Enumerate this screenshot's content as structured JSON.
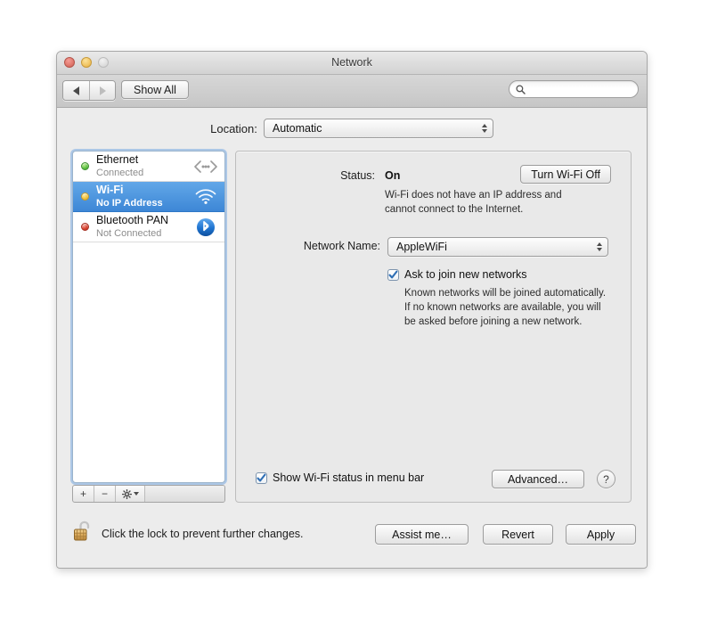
{
  "window": {
    "title": "Network",
    "traffic_lights": [
      "close",
      "minimize",
      "zoom"
    ]
  },
  "toolbar": {
    "back_icon": "triangle-left-icon",
    "forward_icon": "triangle-right-icon",
    "show_all_label": "Show All",
    "search": {
      "value": "",
      "placeholder": "",
      "icon": "search-icon"
    }
  },
  "location": {
    "label": "Location:",
    "value": "Automatic"
  },
  "sidebar": {
    "services": [
      {
        "name": "Ethernet",
        "status": "Connected",
        "dot": "green",
        "icon": "ethernet-icon",
        "selected": false
      },
      {
        "name": "Wi-Fi",
        "status": "No IP Address",
        "dot": "amber",
        "icon": "wifi-icon",
        "selected": true
      },
      {
        "name": "Bluetooth PAN",
        "status": "Not Connected",
        "dot": "red",
        "icon": "bluetooth-icon",
        "selected": false
      }
    ],
    "footer": {
      "add_label": "+",
      "remove_label": "−",
      "action_icon": "gear-icon"
    }
  },
  "detail": {
    "status_label": "Status:",
    "status_value": "On",
    "turn_off_label": "Turn Wi-Fi Off",
    "status_description": "Wi-Fi does not have an IP address and\ncannot connect to the Internet.",
    "status_description_line1": "Wi-Fi does not have an IP address and",
    "status_description_line2": "cannot connect to the Internet.",
    "network_name_label": "Network Name:",
    "network_name_value": "AppleWiFi",
    "ask_join_label": "Ask to join new networks",
    "ask_join_checked": true,
    "ask_join_help_line1": "Known networks will be joined automatically.",
    "ask_join_help_line2": "If no known networks are available, you will",
    "ask_join_help_line3": "be asked before joining a new network.",
    "show_status_label": "Show Wi-Fi status in menu bar",
    "show_status_checked": true,
    "advanced_label": "Advanced…",
    "help_label": "?"
  },
  "bottom": {
    "lock_icon": "unlocked-padlock-icon",
    "lock_text": "Click the lock to prevent further changes.",
    "assist_label": "Assist me…",
    "revert_label": "Revert",
    "apply_label": "Apply"
  },
  "colors": {
    "selection_blue": "#3d87d6",
    "status_green": "#5fc345",
    "status_amber": "#f2c43f",
    "status_red": "#d9412f",
    "bluetooth_blue": "#1f74d0",
    "window_bg": "#ececec"
  }
}
